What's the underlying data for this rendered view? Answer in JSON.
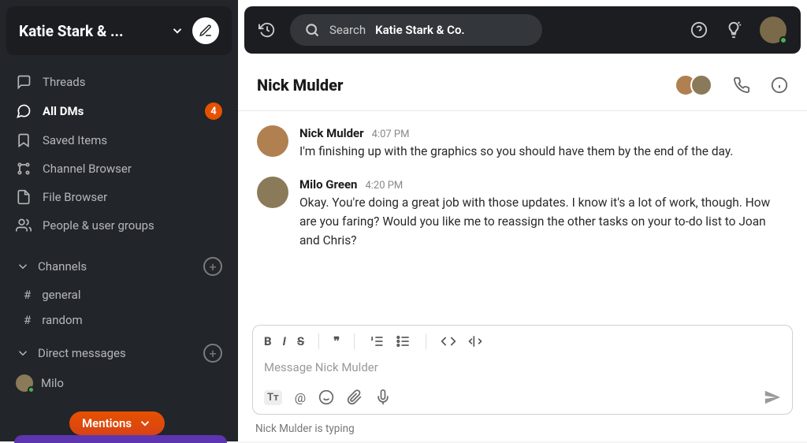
{
  "workspace": {
    "title": "Katie Stark & ..."
  },
  "nav": {
    "threads": "Threads",
    "all_dms": "All DMs",
    "all_dms_badge": "4",
    "saved": "Saved Items",
    "channel_browser": "Channel Browser",
    "file_browser": "File Browser",
    "people": "People & user groups"
  },
  "sections": {
    "channels": "Channels",
    "direct_messages": "Direct messages"
  },
  "channels": [
    {
      "name": "general"
    },
    {
      "name": "random"
    }
  ],
  "dms": [
    {
      "name": "Milo"
    }
  ],
  "mentions_pill": "Mentions",
  "search": {
    "label": "Search",
    "scope": "Katie Stark & Co."
  },
  "conversation": {
    "title": "Nick Mulder"
  },
  "messages": [
    {
      "author": "Nick Mulder",
      "time": "4:07 PM",
      "body": "I'm finishing up with the graphics so you should have them by the end of the day."
    },
    {
      "author": "Milo Green",
      "time": "4:20 PM",
      "body": "Okay. You're doing a great job with those updates. I know it's a lot of work, though. How are you faring? Would you like me to reassign the other tasks on your to-do list to Joan and Chris?"
    }
  ],
  "composer": {
    "placeholder": "Message Nick Mulder"
  },
  "typing": "Nick Mulder is typing"
}
